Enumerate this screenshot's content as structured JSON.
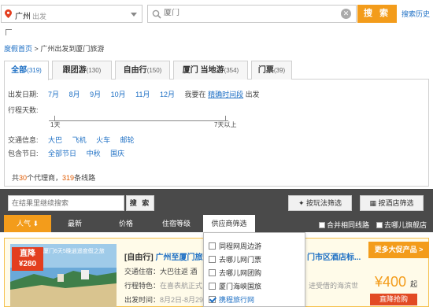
{
  "search": {
    "from_city": "广州",
    "from_hint": "出发",
    "to_placeholder": "厦门",
    "button": "搜 索",
    "history": "搜索历史"
  },
  "breadcrumb": {
    "home": "度假首页",
    "separator": ">",
    "current": "广州出发到厦门旅游"
  },
  "tabs": [
    {
      "label": "全部",
      "count": "(319)"
    },
    {
      "label": "跟团游",
      "count": "(130)"
    },
    {
      "label": "自由行",
      "count": "(150)"
    },
    {
      "label": "厦门 当地游",
      "count": "(354)"
    },
    {
      "label": "门票",
      "count": "(39)"
    }
  ],
  "filters": {
    "date_label": "出发日期:",
    "months": [
      "7月",
      "8月",
      "9月",
      "10月",
      "11月",
      "12月"
    ],
    "date_hint": "我要在",
    "date_hint_link": "精确时间段",
    "date_hint_end": "出发",
    "days_label": "行程天数:",
    "days_min": "1天",
    "days_max": "7天以上",
    "transport_label": "交通信息:",
    "transport": [
      "大巴",
      "飞机",
      "火车",
      "邮轮"
    ],
    "holiday_label": "包含节日:",
    "holidays": [
      "全部节日",
      "中秋",
      "国庆"
    ]
  },
  "agency_summary": {
    "prefix": "共",
    "agencies": "30",
    "middle": "个代理商，",
    "routes": "319",
    "suffix": "条线路"
  },
  "toolbar": {
    "inner_search_placeholder": "在结果里继续搜索",
    "inner_search_button": "搜 索",
    "play_filter": "按玩法筛选",
    "hotel_filter": "按酒店筛选",
    "sorts": [
      "人气",
      "最新",
      "价格",
      "住宿等级",
      "供应商筛选"
    ],
    "merge_routes": "合并相同线路",
    "go_where": "去哪儿旗舰店"
  },
  "dropdown": [
    {
      "label": "同程网周边游",
      "checked": false
    },
    {
      "label": "去哪儿网门票",
      "checked": false
    },
    {
      "label": "去哪儿网团购",
      "checked": false
    },
    {
      "label": "厦门海峡国旅",
      "checked": false
    },
    {
      "label": "携程旅行网",
      "checked": true
    }
  ],
  "product": {
    "badge_title": "直降",
    "badge_amount": "¥280",
    "photo_caption": "厦门6天5晚逍遥度假之旅",
    "title_tag": "[自由行]",
    "title": "广州至厦门旅游",
    "title_tail": "门市区酒店标...",
    "transport_label": "交通住宿：",
    "transport_value": "大巴往返",
    "transport_tail": "酒",
    "feature_label": "行程特色：",
    "feature_value": "在喜表航正式",
    "feature_tail": "进受借的海滨世",
    "depart_label": "出发时间：",
    "depart_value": "8月2日-8月29",
    "more_button": "更多大促产品 >",
    "price": "¥400",
    "price_unit": "起",
    "buy_button": "直降抢购"
  }
}
